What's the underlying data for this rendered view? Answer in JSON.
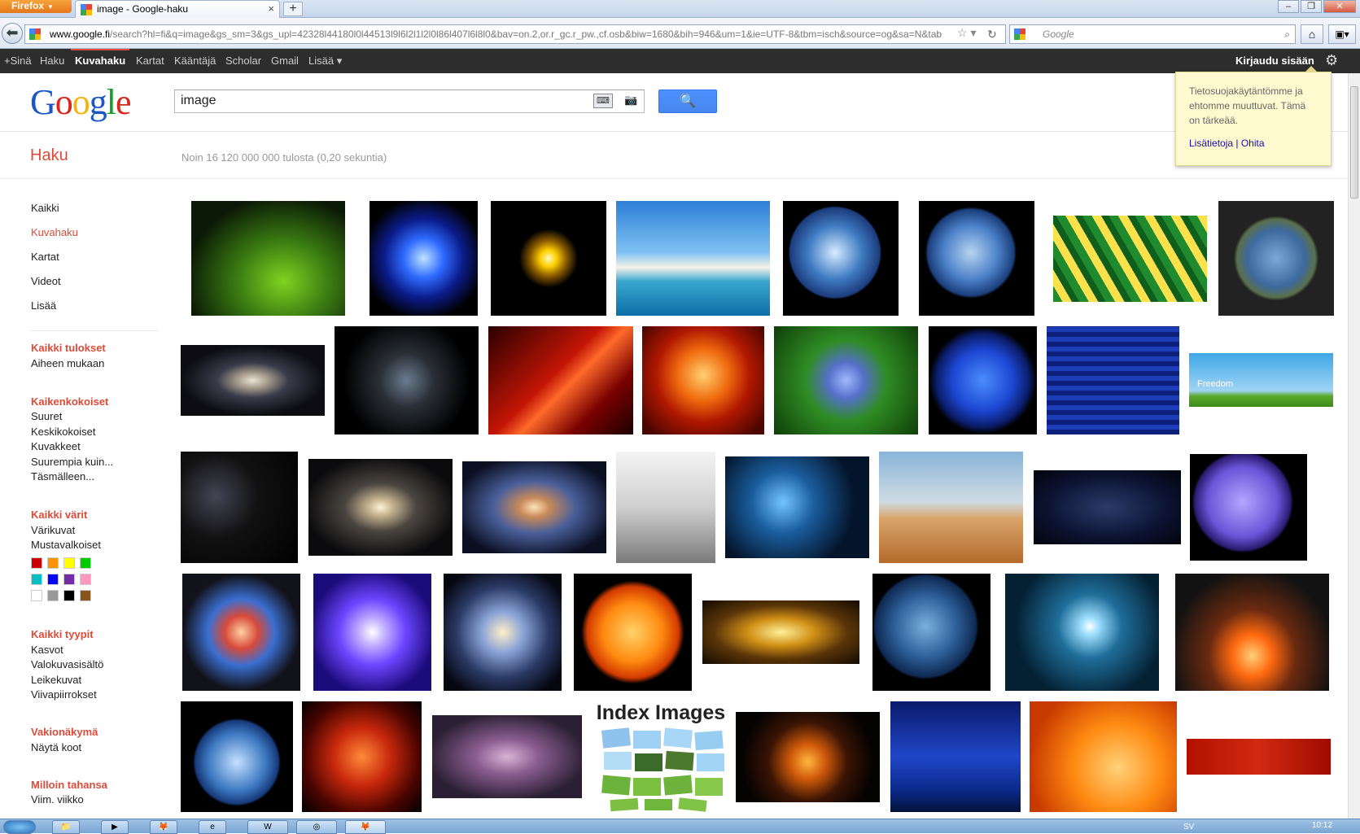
{
  "browser": {
    "app_button": "Firefox",
    "tab_title": "image - Google-haku",
    "new_tab": "+",
    "url_host": "www.google.fi",
    "url_rest": "/search?hl=fi&q=image&gs_sm=3&gs_upl=42328l44180l0l44513l9l6l2l1l2l0l86l407l6l8l0&bav=on.2,or.r_gc.r_pw.,cf.osb&biw=1680&bih=946&um=1&ie=UTF-8&tbm=isch&source=og&sa=N&tab",
    "search_engine_placeholder": "Google",
    "add_icon": "add-bookmark"
  },
  "gbar": {
    "items": [
      "+Sinä",
      "Haku",
      "Kuvahaku",
      "Kartat",
      "Kääntäjä",
      "Scholar",
      "Gmail",
      "Lisää ▾"
    ],
    "signin": "Kirjaudu sisään"
  },
  "search": {
    "query": "image",
    "logo": [
      "G",
      "o",
      "o",
      "g",
      "l",
      "e"
    ]
  },
  "header": {
    "section": "Haku",
    "stats": "Noin 16 120 000 000 tulosta (0,20 sekuntia)"
  },
  "popup": {
    "text": "Tietosuojakäytäntömme ja ehtomme muuttuvat. Tämä on tärkeää.",
    "link1": "Lisätietoja",
    "sep": " | ",
    "link2": "Ohita"
  },
  "sidebar": {
    "nav": [
      "Kaikki",
      "Kuvahaku",
      "Kartat",
      "Videot",
      "Lisää"
    ],
    "selected": "Kuvahaku",
    "groups": [
      {
        "head": "Kaikki tulokset",
        "opts": [
          "Aiheen mukaan"
        ]
      },
      {
        "head": "Kaikenkokoiset",
        "opts": [
          "Suuret",
          "Keskikokoiset",
          "Kuvakkeet",
          "Suurempia kuin...",
          "Täsmälleen..."
        ]
      },
      {
        "head": "Kaikki värit",
        "opts": [
          "Värikuvat",
          "Mustavalkoiset"
        ]
      },
      {
        "head": "Kaikki tyypit",
        "opts": [
          "Kasvot",
          "Valokuvasisältö",
          "Leikekuvat",
          "Viivapiirrokset"
        ]
      },
      {
        "head": "Vakionäkymä",
        "opts": [
          "Näytä koot"
        ]
      },
      {
        "head": "Milloin tahansa",
        "opts": [
          "Viim. viikko"
        ]
      }
    ],
    "colors": [
      "#cc0000",
      "#fb940b",
      "#ffff00",
      "#00cc00",
      "#03c0c6",
      "#0000ff",
      "#762ca7",
      "#ff98bf",
      "#ffffff",
      "#999999",
      "#000000",
      "#885418"
    ]
  },
  "results": {
    "index_images_title": "Index Images",
    "freedom_caption": "Freedom"
  },
  "taskbar": {
    "lang": "SV",
    "clock": "10:12"
  }
}
